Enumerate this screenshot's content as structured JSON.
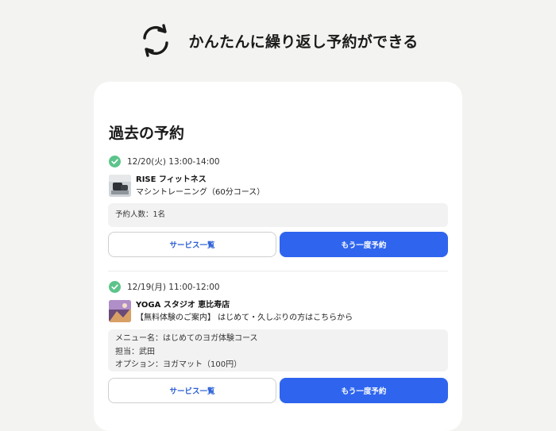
{
  "header": {
    "title": "かんたんに繰り返し予約ができる",
    "icon": "refresh-icon"
  },
  "card": {
    "title": "過去の予約",
    "reservations": [
      {
        "status_icon": "check-circle-icon",
        "status_color": "#5cc48a",
        "datetime": "12/20(火) 13:00-14:00",
        "shop_name": "RISE フィットネス",
        "course": "マシントレーニング（60分コース）",
        "details": [
          "予約人数：1名"
        ],
        "buttons": {
          "services": "サービス一覧",
          "rebook": "もう一度予約"
        }
      },
      {
        "status_icon": "check-circle-icon",
        "status_color": "#5cc48a",
        "datetime": "12/19(月) 11:00-12:00",
        "shop_name": "YOGA スタジオ 恵比寿店",
        "course": "【無料体験のご案内】 はじめて・久しぶりの方はこちらから",
        "details": [
          "メニュー名：はじめてのヨガ体験コース",
          "担当：武田",
          "オプション：ヨガマット（100円）"
        ],
        "buttons": {
          "services": "サービス一覧",
          "rebook": "もう一度予約"
        }
      }
    ]
  },
  "colors": {
    "background": "#f3f3f1",
    "primary": "#2f65ee",
    "link": "#2a5fd6",
    "success": "#5cc48a"
  }
}
